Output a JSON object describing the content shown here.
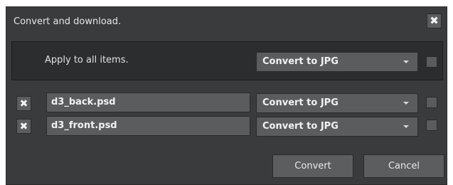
{
  "dialog": {
    "title": "Convert and download.",
    "close_glyph": "✖"
  },
  "apply_all": {
    "label": "Apply to all  items.",
    "format": "Convert to JPG",
    "checked": false
  },
  "items": [
    {
      "remove_glyph": "✖",
      "filename": "d3_back.psd",
      "format": "Convert to JPG",
      "checked": false
    },
    {
      "remove_glyph": "✖",
      "filename": "d3_front.psd",
      "format": "Convert to JPG",
      "checked": false
    }
  ],
  "buttons": {
    "convert": "Convert",
    "cancel": "Cancel"
  },
  "icons": {
    "close": "close-icon",
    "remove": "close-icon",
    "dropdown": "chevron-down-icon"
  }
}
